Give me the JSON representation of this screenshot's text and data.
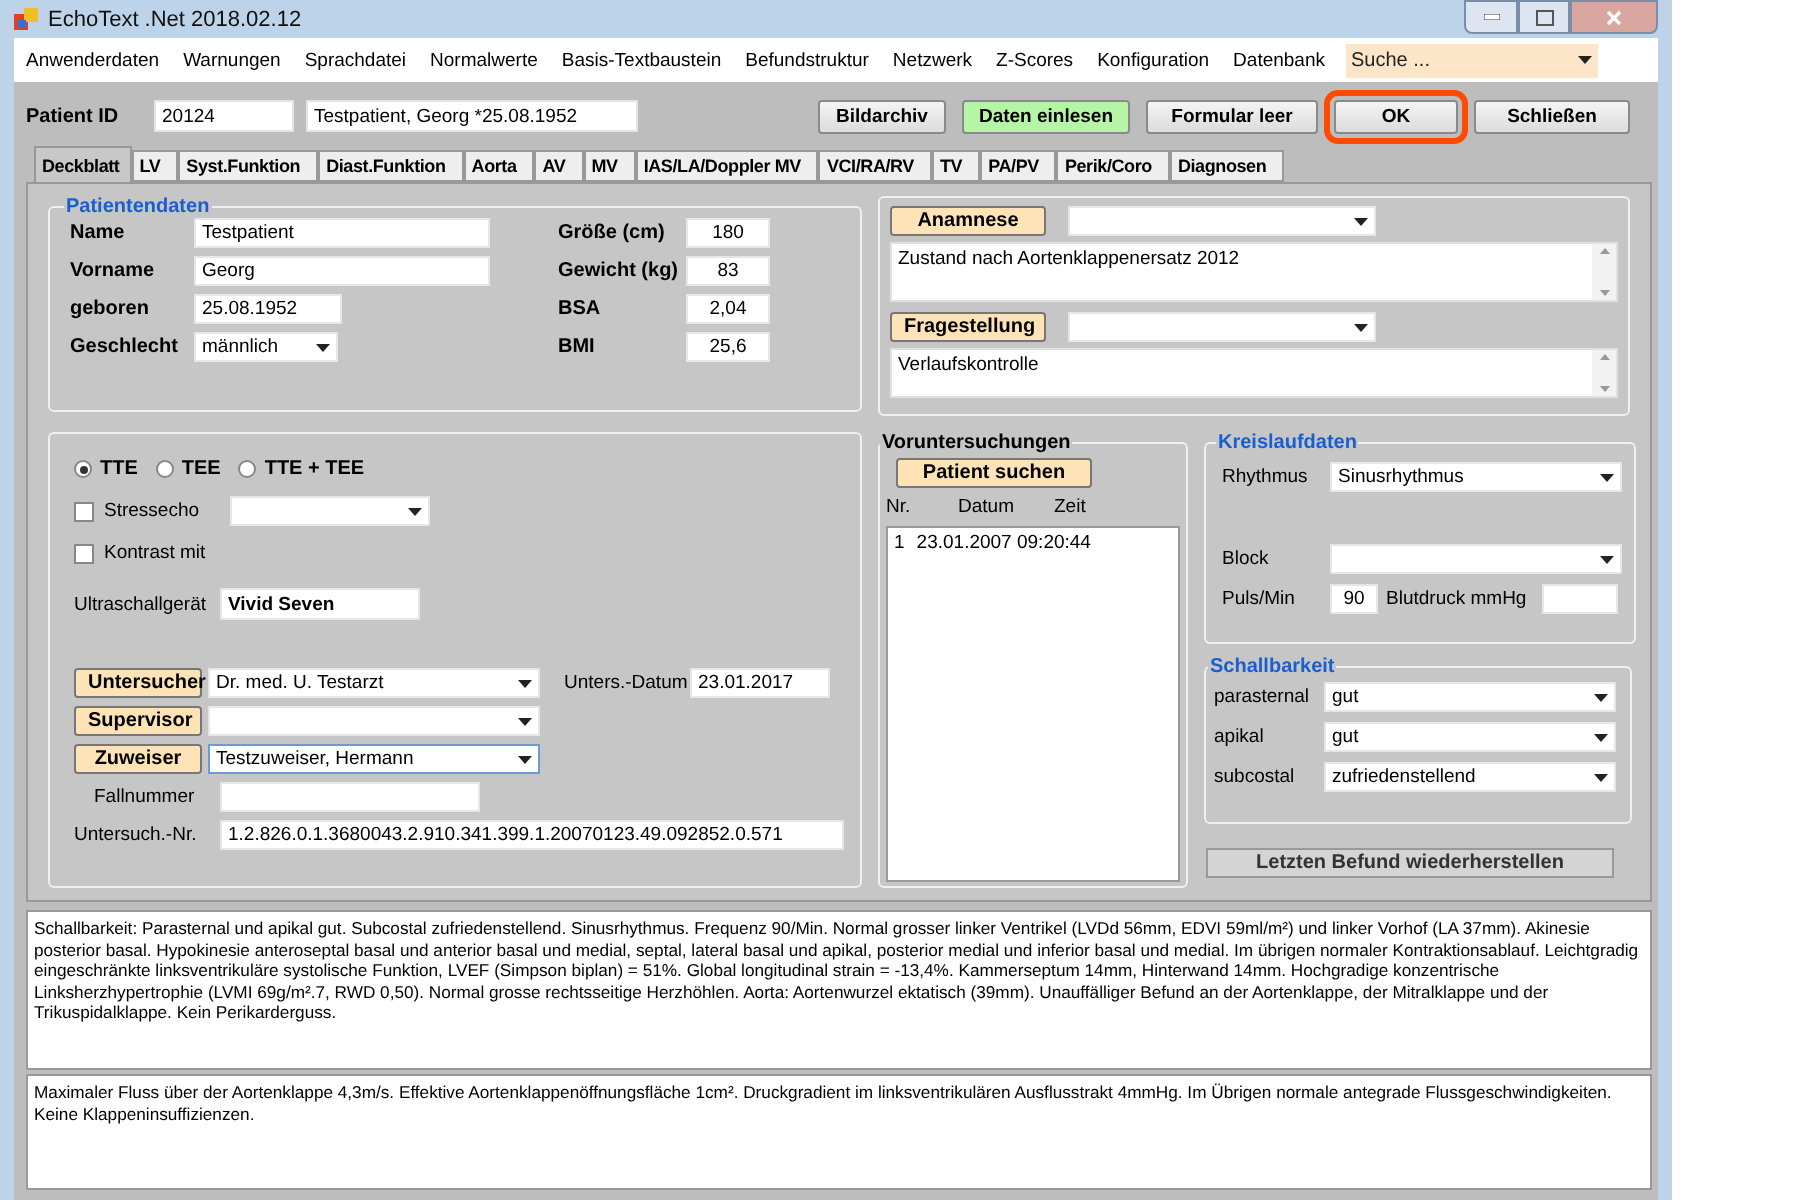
{
  "window": {
    "title": "EchoText .Net 2018.02.12"
  },
  "menu": [
    "Anwenderdaten",
    "Warnungen",
    "Sprachdatei",
    "Normalwerte",
    "Basis-Textbaustein",
    "Befundstruktur",
    "Netzwerk",
    "Z-Scores",
    "Konfiguration",
    "Datenbank"
  ],
  "search": {
    "placeholder": "Suche ..."
  },
  "patient": {
    "id_label": "Patient ID",
    "id": "20124",
    "name": "Testpatient, Georg *25.08.1952"
  },
  "toolbar_buttons": [
    {
      "label": "Bildarchiv",
      "kind": "plain"
    },
    {
      "label": "Daten einlesen",
      "kind": "green"
    },
    {
      "label": "Formular leer",
      "kind": "plain"
    },
    {
      "label": "OK",
      "kind": "marked"
    },
    {
      "label": "Schließen",
      "kind": "plain"
    }
  ],
  "tabs": [
    {
      "label": "Deckblatt",
      "selected": true
    },
    {
      "label": "LV",
      "selected": false
    },
    {
      "label": "Syst.Funktion",
      "selected": false
    },
    {
      "label": "Diast.Funktion",
      "selected": false
    },
    {
      "label": "Aorta",
      "selected": false
    },
    {
      "label": "AV",
      "selected": false
    },
    {
      "label": "MV",
      "selected": false
    },
    {
      "label": "IAS/LA/Doppler MV",
      "selected": false
    },
    {
      "label": "VCI/RA/RV",
      "selected": false
    },
    {
      "label": "TV",
      "selected": false
    },
    {
      "label": "PA/PV",
      "selected": false
    },
    {
      "label": "Perik/Coro",
      "selected": false
    },
    {
      "label": "Diagnosen",
      "selected": false
    }
  ],
  "patientendaten": {
    "title": "Patientendaten",
    "left": [
      {
        "label": "Name",
        "value": "Testpatient",
        "kind": "text"
      },
      {
        "label": "Vorname",
        "value": "Georg",
        "kind": "text"
      },
      {
        "label": "geboren",
        "value": "25.08.1952",
        "kind": "text"
      },
      {
        "label": "Geschlecht",
        "value": "männlich",
        "kind": "dropdown"
      }
    ],
    "right": [
      {
        "label": "Größe (cm)",
        "value": "180"
      },
      {
        "label": "Gewicht (kg)",
        "value": "83"
      },
      {
        "label": "BSA",
        "value": "2,04"
      },
      {
        "label": "BMI",
        "value": "25,6"
      }
    ]
  },
  "anamnese": [
    {
      "button": "Anamnese",
      "text": "Zustand nach Aortenklappenersatz 2012"
    },
    {
      "button": "Fragestellung",
      "text": "Verlaufskontrolle"
    }
  ],
  "exam": {
    "modes": [
      {
        "label": "TTE",
        "selected": true
      },
      {
        "label": "TEE",
        "selected": false
      },
      {
        "label": "TTE + TEE",
        "selected": false
      }
    ],
    "checks": [
      {
        "label": "Stressecho",
        "checked": false,
        "kind": "dropdown"
      },
      {
        "label": "Kontrast mit",
        "checked": false,
        "kind": "plain"
      }
    ],
    "device": {
      "label": "Ultraschallgerät",
      "value": "Vivid Seven"
    },
    "persons": [
      {
        "button": "Untersucher",
        "value": "Dr. med. U. Testarzt"
      },
      {
        "button": "Supervisor"
      },
      {
        "button": "Zuweiser",
        "value": "Testzuweiser, Hermann"
      }
    ],
    "date": {
      "label": "Unters.-Datum",
      "value": "23.01.2017"
    },
    "case": {
      "label": "Fallnummer"
    },
    "exam_no": {
      "label": "Untersuch.-Nr.",
      "value": "1.2.826.0.1.3680043.2.910.341.399.1.20070123.49.092852.0.571"
    }
  },
  "voruntersuchungen": {
    "title": "Voruntersuchungen",
    "button": "Patient suchen",
    "columns": [
      "Nr.",
      "Datum",
      "Zeit"
    ],
    "rows": [
      {
        "nr": "1",
        "datetime": "23.01.2007 09:20:44"
      }
    ]
  },
  "kreislauf": {
    "title": "Kreislaufdaten",
    "rhythmus": {
      "label": "Rhythmus",
      "value": "Sinusrhythmus"
    },
    "block": {
      "label": "Block"
    },
    "puls": {
      "label": "Puls/Min",
      "value": "90"
    },
    "blutdruck": {
      "label": "Blutdruck mmHg"
    }
  },
  "schallbarkeit": {
    "title": "Schallbarkeit",
    "rows": [
      {
        "label": "parasternal",
        "value": "gut"
      },
      {
        "label": "apikal",
        "value": "gut"
      },
      {
        "label": "subcostal",
        "value": "zufriedenstellend"
      }
    ]
  },
  "restore_button": "Letzten Befund wiederherstellen",
  "report": [
    "Schallbarkeit: Parasternal und apikal gut. Subcostal zufriedenstellend. Sinusrhythmus. Frequenz 90/Min. Normal grosser linker Ventrikel (LVDd 56mm, EDVI 59ml/m²) und linker Vorhof (LA 37mm). Akinesie posterior basal. Hypokinesie anteroseptal basal und anterior basal und medial, septal, lateral basal und apikal, posterior medial und inferior basal und medial. Im übrigen normaler Kontraktionsablauf. Leichtgradig eingeschränkte linksventrikuläre systolische Funktion, LVEF (Simpson biplan) = 51%. Global longitudinal strain = -13,4%. Kammerseptum 14mm, Hinterwand 14mm. Hochgradige konzentrische Linksherzhypertrophie (LVMI 69g/m².7, RWD 0,50). Normal grosse rechtsseitige Herzhöhlen. Aorta: Aortenwurzel ektatisch (39mm). Unauffälliger Befund an der Aortenklappe, der Mitralklappe und der Trikuspidalklappe. Kein Perikarderguss.",
    "Maximaler Fluss über der Aortenklappe 4,3m/s. Effektive Aortenklappenöffnungsfläche 1cm². Druckgradient im linksventrikulären Ausflusstrakt 4mmHg. Im Übrigen normale antegrade Flussgeschwindigkeiten. Keine Klappeninsuffizienzen."
  ]
}
